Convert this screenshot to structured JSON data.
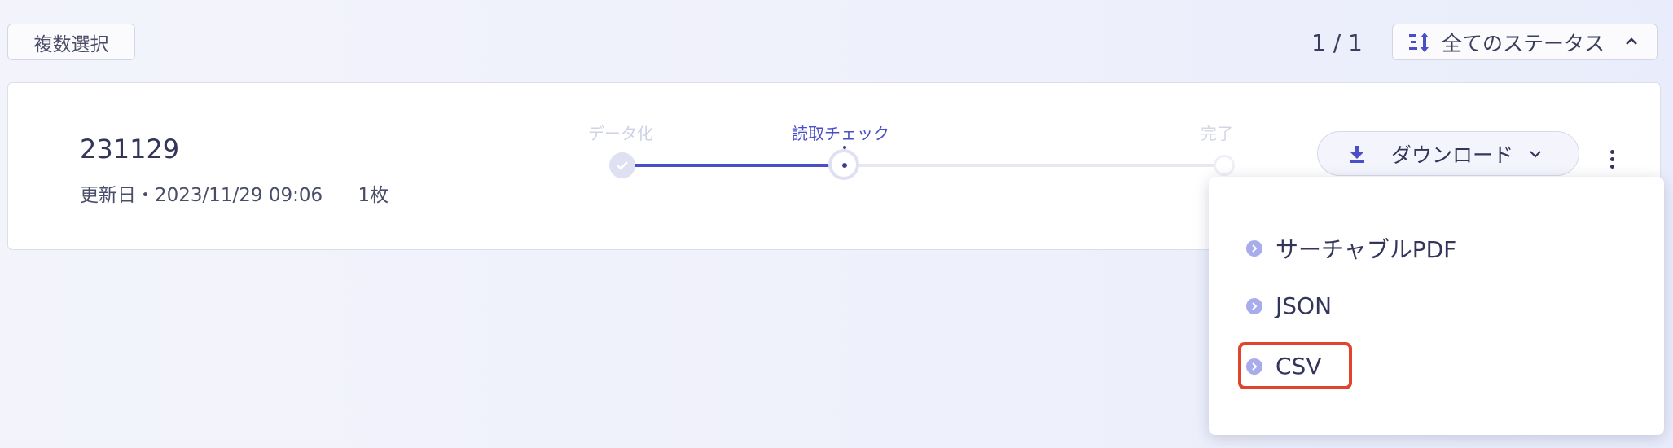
{
  "toolbar": {
    "multi_select_label": "複数選択",
    "pagination": "1 / 1",
    "status_filter_label": "全てのステータス"
  },
  "card": {
    "title": "231129",
    "updated": "更新日・2023/11/29 09:06",
    "pages": "1枚",
    "steps": [
      {
        "label": "データ化",
        "state": "done"
      },
      {
        "label": "読取チェック",
        "state": "active"
      },
      {
        "label": "完了",
        "state": "pending"
      }
    ],
    "download_label": "ダウンロード"
  },
  "download_menu": {
    "items": [
      {
        "label": "サーチャブルPDF"
      },
      {
        "label": "JSON"
      },
      {
        "label": "CSV"
      }
    ],
    "highlighted_item": "CSV"
  },
  "colors": {
    "accent": "#4b4fc7",
    "highlight": "#e0442c",
    "bullet": "#a9acec"
  },
  "icons": [
    "sort-icon",
    "chevron-up-icon",
    "check-icon",
    "download-icon",
    "chevron-down-icon",
    "more-vert-icon",
    "chevron-right-icon"
  ]
}
